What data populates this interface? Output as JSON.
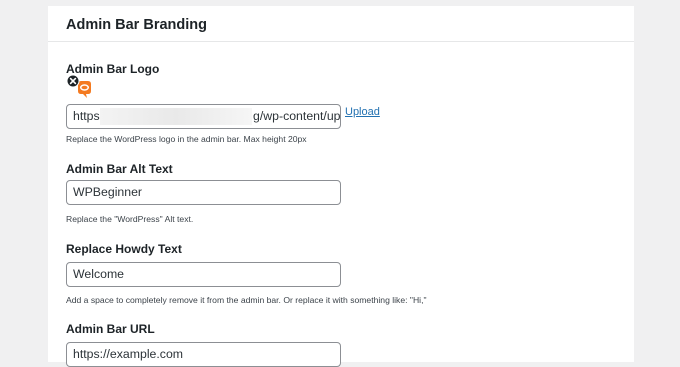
{
  "section": {
    "title": "Admin Bar Branding"
  },
  "logo": {
    "label": "Admin Bar Logo",
    "url_start": "https:/",
    "url_end": "g/wp-content/uplo",
    "upload_label": "Upload",
    "help": "Replace the WordPress logo in the admin bar. Max height 20px"
  },
  "alt_text": {
    "label": "Admin Bar Alt Text",
    "value": "WPBeginner",
    "help": "Replace the \"WordPress\" Alt text."
  },
  "howdy": {
    "label": "Replace Howdy Text",
    "value": "Welcome",
    "help": "Add a space to completely remove it from the admin bar. Or replace it with something like: \"Hi,\""
  },
  "bar_url": {
    "label": "Admin Bar URL",
    "value": "https://example.com"
  },
  "colors": {
    "accent": "#2271b1",
    "logo_orange": "#f47a20"
  }
}
